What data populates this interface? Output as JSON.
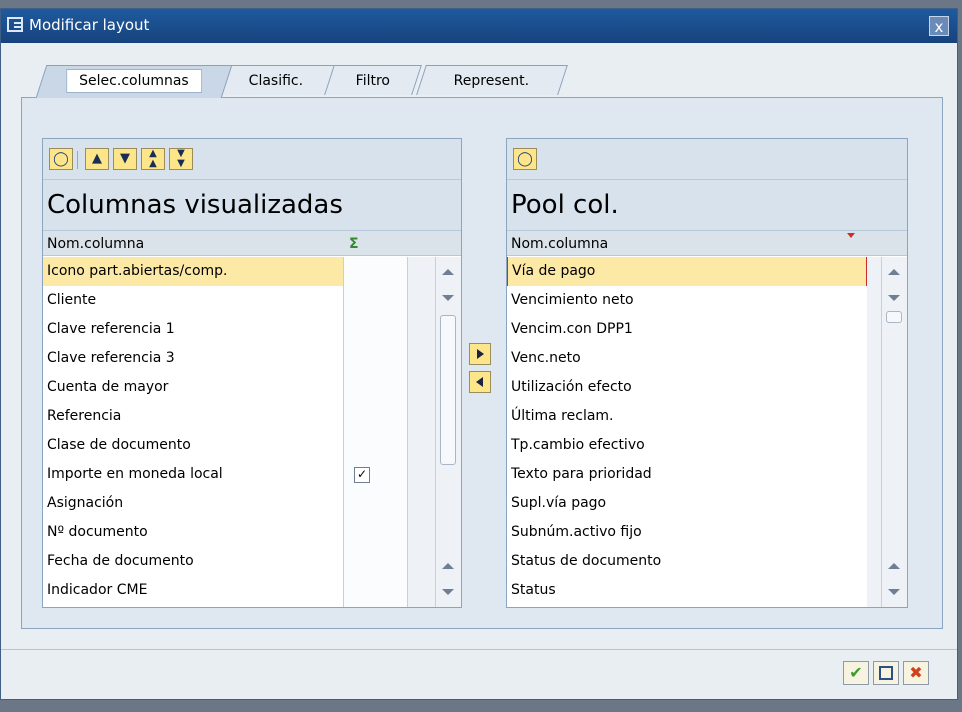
{
  "window": {
    "title": "Modificar layout",
    "close_label": "x"
  },
  "tabs": [
    {
      "label": "Selec.columnas"
    },
    {
      "label": "Clasific."
    },
    {
      "label": "Filtro"
    },
    {
      "label": "Represent."
    }
  ],
  "left_list": {
    "heading": "Columnas visualizadas",
    "col_header": "Nom.columna",
    "sum_icon": "Σ",
    "rows": [
      {
        "label": "Icono part.abiertas/comp.",
        "checked": false,
        "selected": true
      },
      {
        "label": "Cliente",
        "checked": false
      },
      {
        "label": "Clave referencia 1",
        "checked": false
      },
      {
        "label": "Clave referencia 3",
        "checked": false
      },
      {
        "label": "Cuenta de mayor",
        "checked": false
      },
      {
        "label": "Referencia",
        "checked": false
      },
      {
        "label": "Clase de documento",
        "checked": false
      },
      {
        "label": "Importe en moneda local",
        "checked": true
      },
      {
        "label": "Asignación",
        "checked": false
      },
      {
        "label": "Nº documento",
        "checked": false
      },
      {
        "label": "Fecha de documento",
        "checked": false
      },
      {
        "label": "Indicador CME",
        "checked": false
      }
    ]
  },
  "right_list": {
    "heading": "Pool col.",
    "col_header": "Nom.columna",
    "rows": [
      {
        "label": "Vía de pago",
        "selected": true
      },
      {
        "label": "Vencimiento neto"
      },
      {
        "label": "Vencim.con DPP1"
      },
      {
        "label": "Venc.neto"
      },
      {
        "label": "Utilización efecto"
      },
      {
        "label": "Última reclam."
      },
      {
        "label": "Tp.cambio efectivo"
      },
      {
        "label": "Texto para prioridad"
      },
      {
        "label": "Supl.vía pago"
      },
      {
        "label": "Subnúm.activo fijo"
      },
      {
        "label": "Status de documento"
      },
      {
        "label": "Status"
      }
    ]
  },
  "icons": {
    "find": "binoculars-icon",
    "up": "arrow-up-icon",
    "down": "arrow-down-icon",
    "top": "arrow-top-icon",
    "bottom": "arrow-bottom-icon",
    "move_right": "arrow-right-icon",
    "move_left": "arrow-left-icon",
    "ok": "checkmark-icon",
    "save": "save-icon",
    "cancel": "cancel-icon"
  },
  "colors": {
    "title_bar": "#1f5a9f",
    "selection": "#fde9a6",
    "button_yellow": "#fde58a",
    "ok_green": "#3c9a2e",
    "cancel_red": "#d2401d"
  }
}
